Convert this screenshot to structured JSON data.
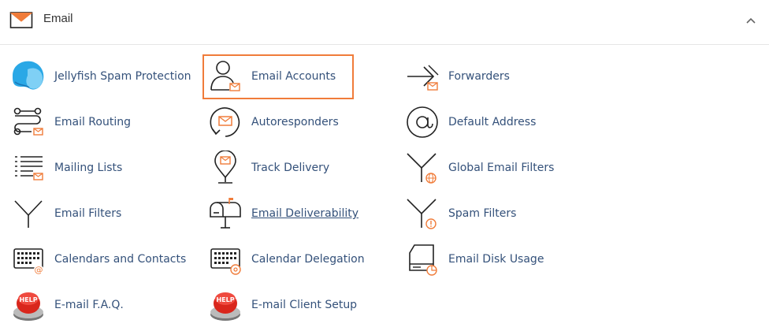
{
  "section": {
    "title": "Email",
    "collapse_icon": "chevron-up-icon"
  },
  "colors": {
    "accent": "#f07c3a",
    "link": "#34517a",
    "icon_stroke": "#222222"
  },
  "items": [
    {
      "label": "Jellyfish Spam Protection",
      "icon": "jellyfish-icon"
    },
    {
      "label": "Email Accounts",
      "icon": "email-accounts-icon",
      "highlighted": true
    },
    {
      "label": "Forwarders",
      "icon": "forwarders-icon"
    },
    {
      "label": "Email Routing",
      "icon": "email-routing-icon"
    },
    {
      "label": "Autoresponders",
      "icon": "autoresponders-icon"
    },
    {
      "label": "Default Address",
      "icon": "at-sign-icon"
    },
    {
      "label": "Mailing Lists",
      "icon": "mailing-lists-icon"
    },
    {
      "label": "Track Delivery",
      "icon": "track-delivery-icon"
    },
    {
      "label": "Global Email Filters",
      "icon": "global-filter-icon"
    },
    {
      "label": "Email Filters",
      "icon": "filter-icon"
    },
    {
      "label": "Email Deliverability",
      "icon": "mailbox-icon",
      "underlined": true
    },
    {
      "label": "Spam Filters",
      "icon": "spam-filter-icon"
    },
    {
      "label": "Calendars and Contacts",
      "icon": "calendar-contacts-icon"
    },
    {
      "label": "Calendar Delegation",
      "icon": "calendar-delegation-icon"
    },
    {
      "label": "Email Disk Usage",
      "icon": "disk-usage-icon"
    },
    {
      "label": "E-mail F.A.Q.",
      "icon": "help-button-icon",
      "badge": "HELP"
    },
    {
      "label": "E-mail Client Setup",
      "icon": "help-button-icon",
      "badge": "HELP"
    }
  ]
}
